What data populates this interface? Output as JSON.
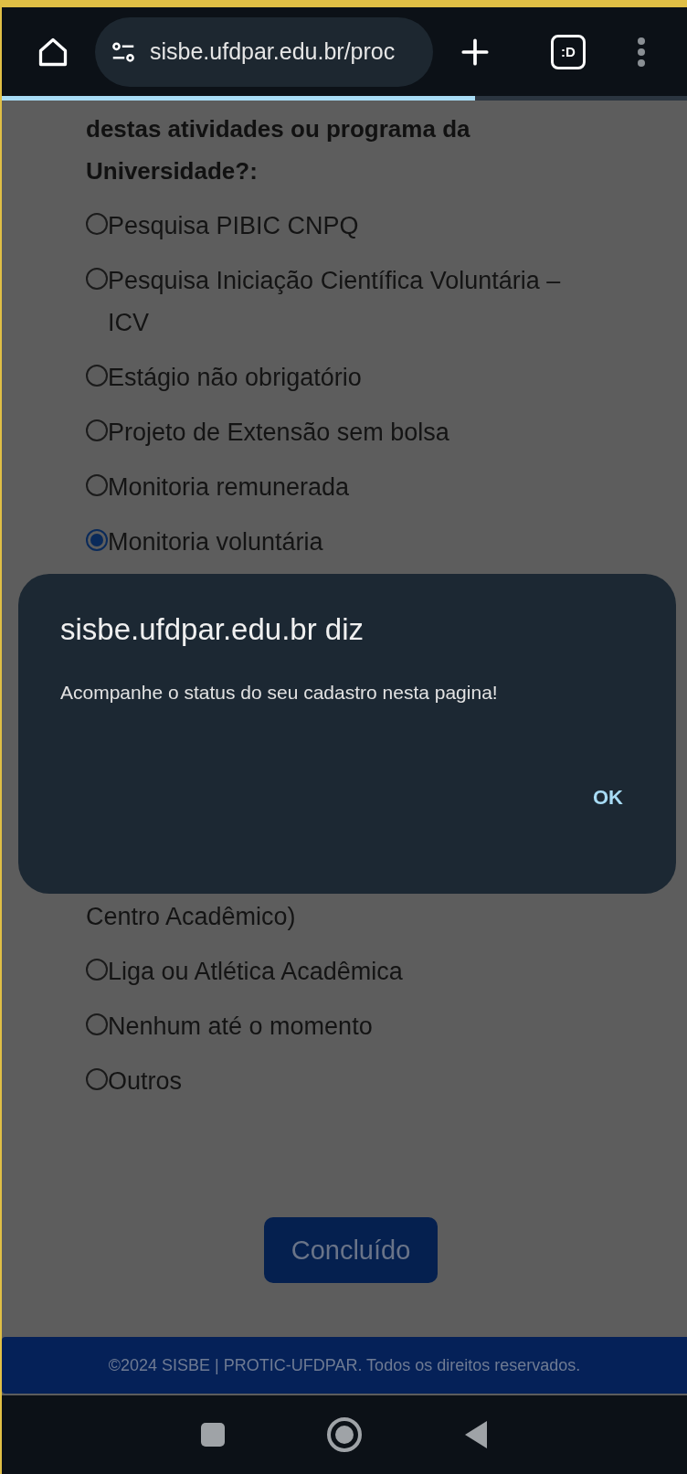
{
  "browser": {
    "url": "sisbe.ufdpar.edu.br/proc",
    "tab_label": ":D",
    "load_progress": {
      "level": 0.69
    }
  },
  "question": {
    "text": "destas atividades ou programa da Universidade?:"
  },
  "options_before": [
    {
      "label": "Pesquisa PIBIC CNPQ",
      "selected": false
    },
    {
      "label": "Pesquisa Iniciação Científica Voluntária – ICV",
      "selected": false
    },
    {
      "label": "Estágio não obrigatório",
      "selected": false
    },
    {
      "label": "Projeto de Extensão sem bolsa",
      "selected": false
    },
    {
      "label": "Monitoria remunerada",
      "selected": false
    },
    {
      "label": "Monitoria voluntária",
      "selected": true
    }
  ],
  "partial_option_text": "Centro Acadêmico)",
  "options_after": [
    {
      "label": "Liga ou Atlética Acadêmica",
      "selected": false
    },
    {
      "label": "Nenhum até o momento",
      "selected": false
    },
    {
      "label": "Outros",
      "selected": false
    }
  ],
  "submit_button": "Concluído",
  "footer": "©2024 SISBE | PROTIC-UFDPAR. Todos os direitos reservados.",
  "dialog": {
    "title": "sisbe.ufdpar.edu.br diz",
    "message": "Acompanhe o status do seu cadastro nesta pagina!",
    "button": "OK"
  }
}
